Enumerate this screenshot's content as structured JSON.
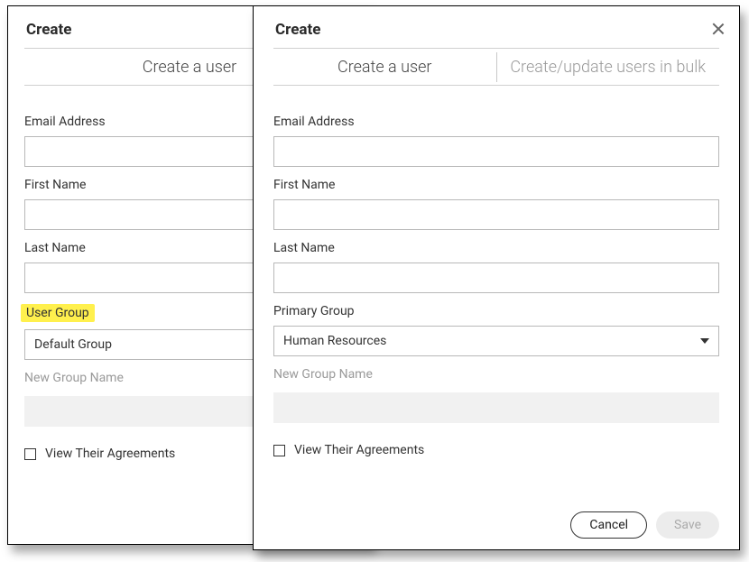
{
  "left": {
    "title": "Create",
    "tab_label": "Create a user",
    "email_label": "Email Address",
    "first_name_label": "First Name",
    "last_name_label": "Last Name",
    "group_label": "User Group",
    "group_value": "Default Group",
    "new_group_label": "New Group Name",
    "view_agreements": "View Their Agreements"
  },
  "right": {
    "title": "Create",
    "tabs": {
      "create_user": "Create a user",
      "bulk": "Create/update users in bulk"
    },
    "email_label": "Email Address",
    "first_name_label": "First Name",
    "last_name_label": "Last Name",
    "group_label": "Primary Group",
    "group_value": "Human Resources",
    "new_group_label": "New Group Name",
    "view_agreements": "View Their Agreements",
    "cancel": "Cancel",
    "save": "Save"
  }
}
